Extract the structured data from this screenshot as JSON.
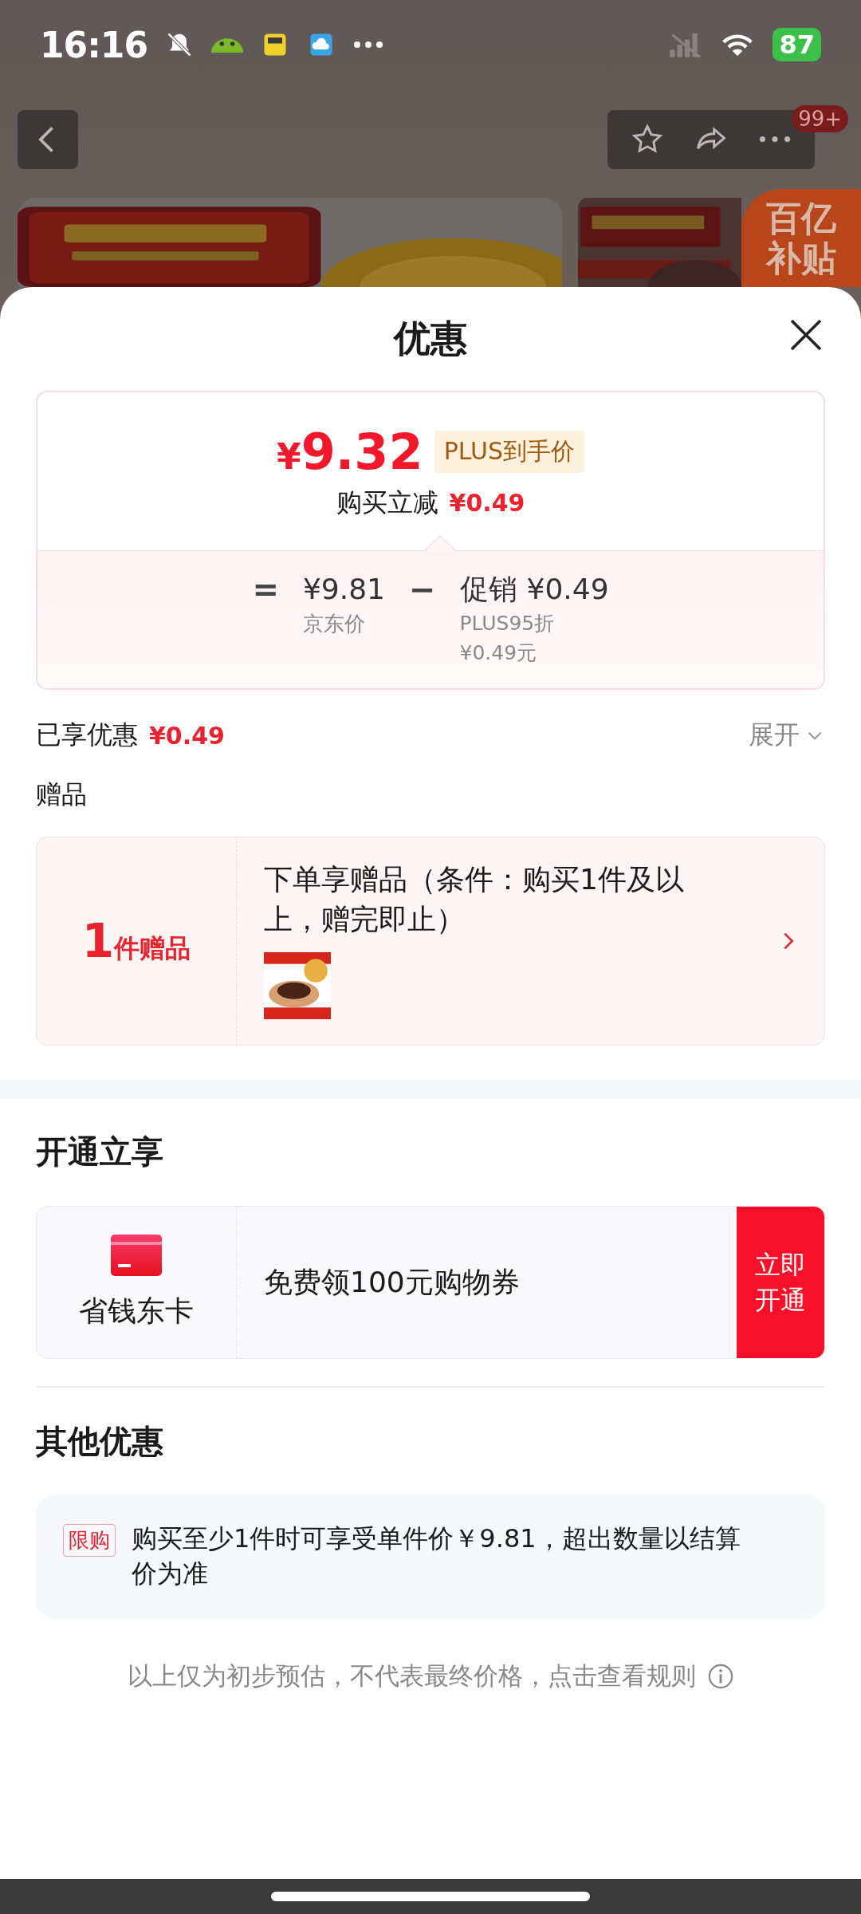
{
  "status_bar": {
    "time": "16:16",
    "battery": "87"
  },
  "nav": {
    "badge": "99+"
  },
  "promo_badge": {
    "lines": [
      "百亿",
      "补贴"
    ]
  },
  "sheet": {
    "title": "优惠"
  },
  "price_card": {
    "price_symbol": "¥",
    "price": "9.32",
    "price_tag": "PLUS到手价",
    "instant_label": "购买立减",
    "instant_amount": "¥0.49",
    "equals": "=",
    "base_price": "¥9.81",
    "base_label": "京东价",
    "minus": "−",
    "promo_label": "促销",
    "promo_amount": "¥0.49",
    "promo_detail_1": "PLUS95折",
    "promo_detail_2": "¥0.49元"
  },
  "enjoyed": {
    "label": "已享优惠",
    "amount": "¥0.49",
    "toggle": "展开",
    "expanded": false
  },
  "gifts": {
    "heading": "赠品",
    "count": "1",
    "count_unit": "件赠品",
    "description": "下单享赠品（条件：购买1件及以上，赠完即止）"
  },
  "membership": {
    "heading": "开通立享",
    "card_name": "省钱东卡",
    "offer": "免费领100元购物券",
    "button": "立即开通"
  },
  "other": {
    "heading": "其他优惠",
    "items": [
      {
        "tag": "限购",
        "text": "购买至少1件时可享受单件价￥9.81，超出数量以结算价为准"
      }
    ]
  },
  "footer": {
    "note": "以上仅为初步预估，不代表最终价格，点击查看规则"
  }
}
